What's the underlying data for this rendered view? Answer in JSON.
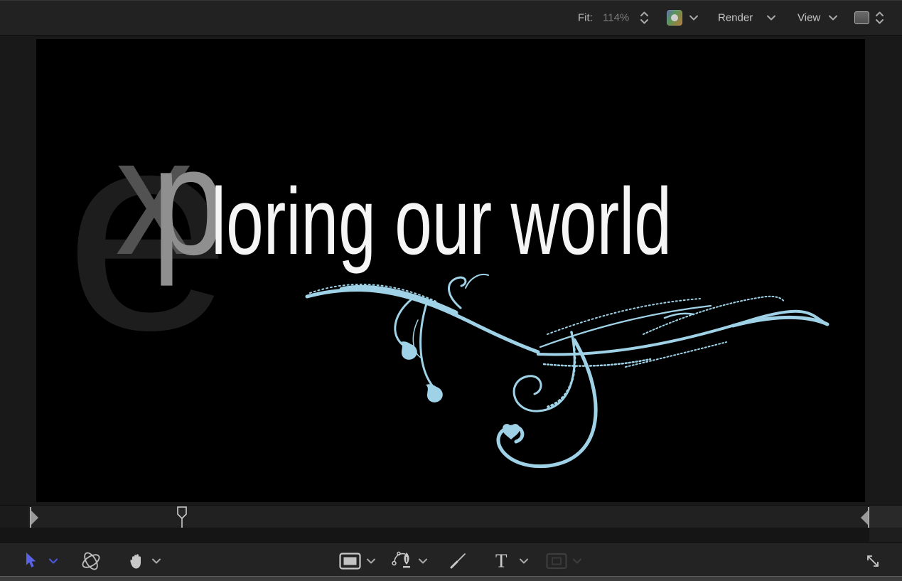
{
  "topbar": {
    "zoom": {
      "label": "Fit:",
      "value": "114%"
    },
    "render_menu": "Render",
    "view_menu": "View"
  },
  "canvas": {
    "ghost_letters": [
      "e",
      "x",
      "p"
    ],
    "title": "loring our world"
  },
  "tools": {
    "text_tool_glyph": "T"
  },
  "icons": {
    "zoom_stepper": "up-down-chevrons",
    "color_swatch": "gradient-color-well-with-dot",
    "render_chevron": "chevron-down",
    "view_chevron": "chevron-down",
    "display_select": "display-well-with-up-down-chevrons",
    "select_tool": "arrow-cursor",
    "orbit_tool": "orbit-ellipses",
    "pan_tool": "hand",
    "rect_tool": "rectangle",
    "bezier_tool": "pen-nib-with-curve",
    "paint_tool": "paintbrush-stroke",
    "text_tool": "serif-letter-T",
    "mask_tool": "rectangle-mask-disabled",
    "expand": "diagonal-resize-arrows",
    "timeline_in_point": "right-triangle-with-bar",
    "timeline_playhead": "hollow-pin-with-stem",
    "timeline_out_point": "left-triangle-with-bar"
  },
  "colors": {
    "topbar_bg": "#222222",
    "viewport_bg": "#191919",
    "canvas_bg": "#000000",
    "toolbar_bg": "#232323",
    "strip_bg": "#151515",
    "timeline_bg": "#212121",
    "flourish": "#9fd2e6",
    "accent_blue": "#5a63e8",
    "icon": "#c6c6c6",
    "disabled": "#3d3d3d",
    "ghost_dim": "#1d1d1d",
    "ghost_mid": "#525252",
    "ghost_light": "#8f8f8f",
    "title": "#f5f5f5"
  }
}
